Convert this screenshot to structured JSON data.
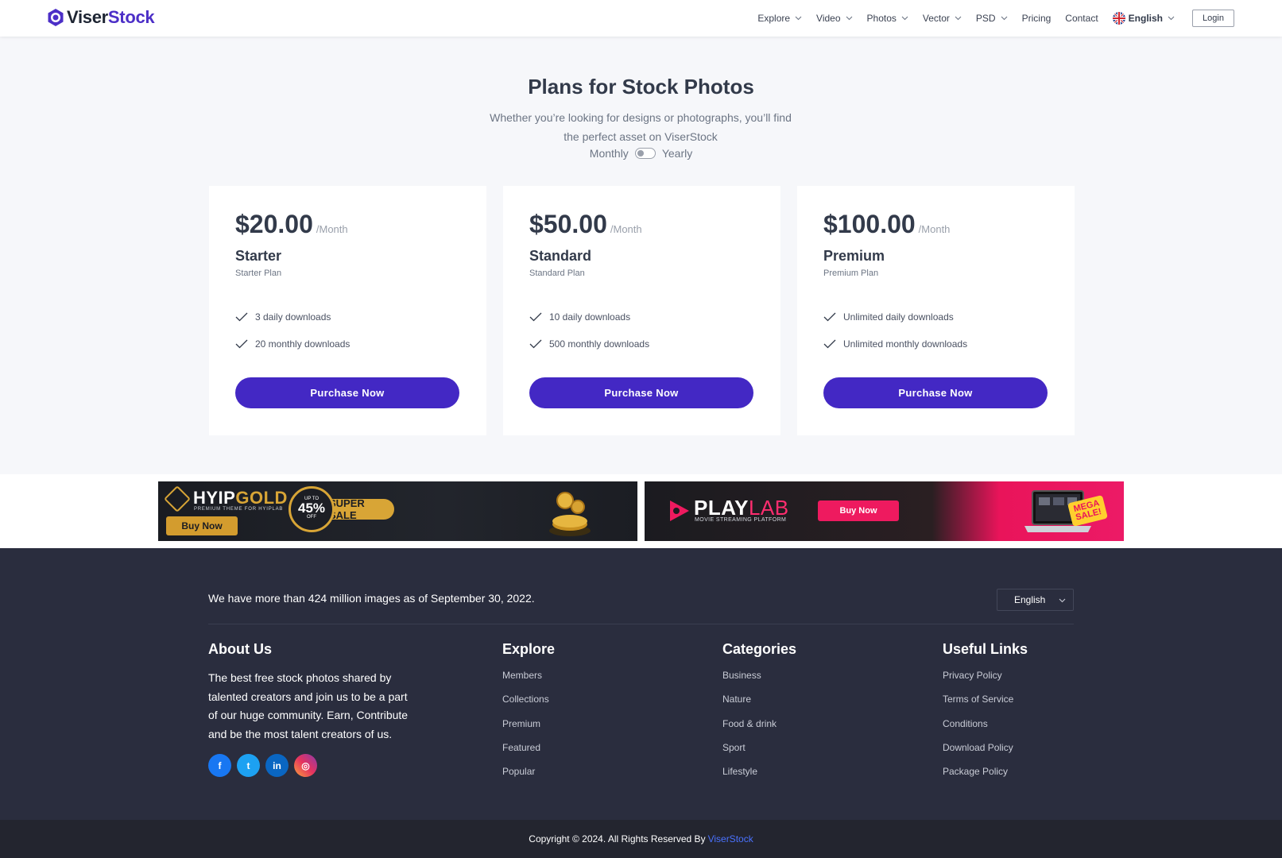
{
  "header": {
    "logo": {
      "part1": "Viser",
      "part2": "Stock"
    },
    "nav": [
      {
        "label": "Explore",
        "dropdown": true
      },
      {
        "label": "Video",
        "dropdown": true
      },
      {
        "label": "Photos",
        "dropdown": true
      },
      {
        "label": "Vector",
        "dropdown": true
      },
      {
        "label": "PSD",
        "dropdown": true
      },
      {
        "label": "Pricing",
        "dropdown": false
      },
      {
        "label": "Contact",
        "dropdown": false
      }
    ],
    "language": "English",
    "login_label": "Login"
  },
  "hero": {
    "title": "Plans for Stock Photos",
    "subtitle": "Whether you’re looking for designs or photographs, you’ll find the perfect asset on ViserStock",
    "toggle_left": "Monthly",
    "toggle_right": "Yearly"
  },
  "plans": [
    {
      "price": "$20.00",
      "period": "/Month",
      "name": "Starter",
      "desc": "Starter Plan",
      "features": [
        "3 daily downloads",
        "20 monthly downloads"
      ],
      "button": "Purchase Now"
    },
    {
      "price": "$50.00",
      "period": "/Month",
      "name": "Standard",
      "desc": "Standard Plan",
      "features": [
        "10 daily downloads",
        "500 monthly downloads"
      ],
      "button": "Purchase Now"
    },
    {
      "price": "$100.00",
      "period": "/Month",
      "name": "Premium",
      "desc": "Premium Plan",
      "features": [
        "Unlimited daily downloads",
        "Unlimited monthly downloads"
      ],
      "button": "Purchase Now"
    }
  ],
  "ads": {
    "hyipgold": {
      "title_a": "HYIP",
      "title_b": "GOLD",
      "tagline": "PREMIUM THEME FOR HYIPLAB",
      "buy": "Buy Now",
      "upto": "UP TO",
      "percent": "45%",
      "off": "OFF",
      "sale": "SUPER SALE"
    },
    "playlab": {
      "title_a": "PLAY",
      "title_b": "LAB",
      "tagline": "MOVIE STREAMING PLATFORM",
      "buy": "Buy Now",
      "mega_a": "MEGA",
      "mega_b": "SALE!"
    }
  },
  "footer": {
    "note": "We have more than 424 million images as of September 30, 2022.",
    "language": "English",
    "about": {
      "title": "About Us",
      "text": "The best free stock photos shared by talented creators and join us to be a part of our huge community. Earn, Contribute and be the most talent creators of us."
    },
    "socials": [
      {
        "icon": "facebook-icon",
        "glyph": "f"
      },
      {
        "icon": "twitter-icon",
        "glyph": "t"
      },
      {
        "icon": "linkedin-icon",
        "glyph": "in"
      },
      {
        "icon": "instagram-icon",
        "glyph": "◎"
      }
    ],
    "explore": {
      "title": "Explore",
      "links": [
        "Members",
        "Collections",
        "Premium",
        "Featured",
        "Popular"
      ]
    },
    "categories": {
      "title": "Categories",
      "links": [
        "Business",
        "Nature",
        "Food & drink",
        "Sport",
        "Lifestyle"
      ]
    },
    "useful": {
      "title": "Useful Links",
      "links": [
        "Privacy Policy",
        "Terms of Service",
        "Conditions",
        "Download Policy",
        "Package Policy"
      ]
    },
    "copyright": "Copyright © 2024. All Rights Reserved By",
    "copyright_brand": "ViserStock"
  },
  "colors": {
    "primary": "#4328c4",
    "footer_bg": "#2a2d3e",
    "copyright_bg": "#23252f",
    "brand_link": "#4a72ff"
  }
}
